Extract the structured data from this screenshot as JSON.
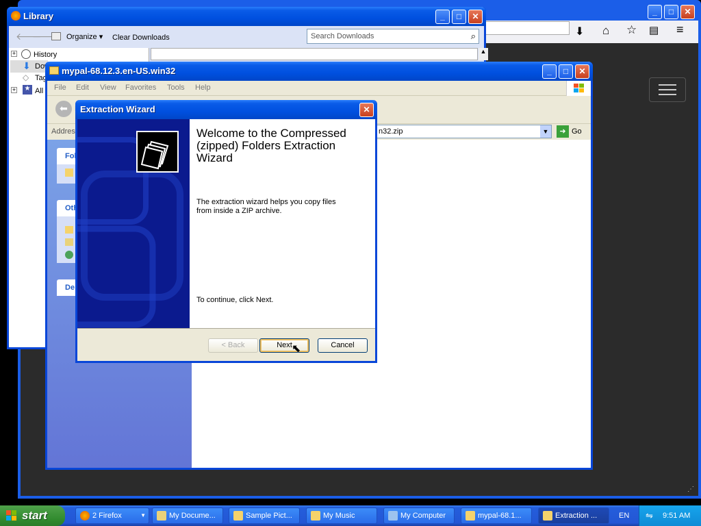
{
  "desktop": {
    "colors": {
      "background": "#000000",
      "xp_blue": "#0a5ce8",
      "wizard_side": "#0b1a8e"
    }
  },
  "firefox": {
    "toolbar_icons": [
      "download-icon",
      "home-icon",
      "star-icon",
      "reader-icon",
      "menu-icon"
    ]
  },
  "library": {
    "title": "Library",
    "organize": "Organize",
    "clear_downloads": "Clear Downloads",
    "search_placeholder": "Search Downloads",
    "tree": [
      "History",
      "Dow",
      "Tag",
      "All"
    ]
  },
  "explorer": {
    "title": "mypal-68.12.3.en-US.win32",
    "menu": [
      "File",
      "Edit",
      "View",
      "Favorites",
      "Tools",
      "Help"
    ],
    "back_label": "B",
    "address_label": "Address",
    "address_value": "n32.zip",
    "go": "Go",
    "panels": [
      "Fol",
      "Oth",
      "De"
    ]
  },
  "wizard": {
    "title": "Extraction Wizard",
    "heading": "Welcome to the Compressed (zipped) Folders Extraction Wizard",
    "description": "The extraction wizard helps you copy files from inside a ZIP archive.",
    "continue_text": "To continue, click Next.",
    "back_label": "< Back",
    "next_label": "Next",
    "cancel_label": "Cancel"
  },
  "taskbar": {
    "start": "start",
    "items": [
      "2 Firefox",
      "My Docume...",
      "Sample Pict...",
      "My Music",
      "My Computer",
      "mypal-68.1...",
      "Extraction ..."
    ],
    "language": "EN",
    "clock": "9:51 AM"
  }
}
